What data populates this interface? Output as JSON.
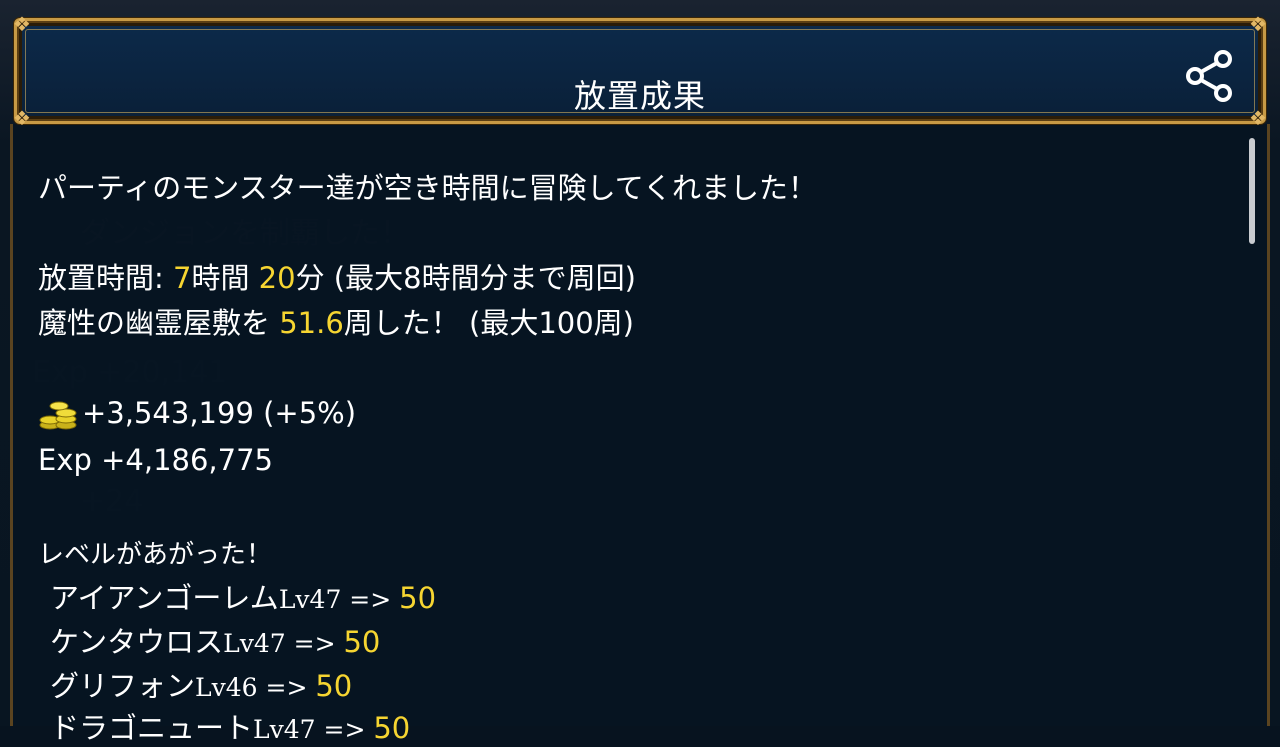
{
  "dialog": {
    "title": "放置成果",
    "share_icon": "share-icon"
  },
  "intro": "パーティのモンスター達が空き時間に冒険してくれました！",
  "idle_time": {
    "label": "放置時間: ",
    "hours": "7",
    "hours_unit": "時間 ",
    "minutes": "20",
    "minutes_unit": "分",
    "note": " (最大8時間分まで周回)"
  },
  "dungeon": {
    "prefix": "魔性の幽霊屋敷を ",
    "laps": "51.6",
    "suffix": "周した！ (最大100周)"
  },
  "rewards": {
    "coin_icon": "gold-coins-icon",
    "gold": "+3,543,199 (+5%)",
    "exp": "Exp +4,186,775"
  },
  "level_up": {
    "heading": "レベルがあがった！",
    "monsters": [
      {
        "name": "アイアンゴーレム",
        "level_text": "Lv47 => ",
        "new_level": "50"
      },
      {
        "name": "ケンタウロス",
        "level_text": "Lv47 => ",
        "new_level": "50"
      },
      {
        "name": "グリフォン",
        "level_text": "Lv46 => ",
        "new_level": "50"
      },
      {
        "name": "ドラゴニュート",
        "level_text": "Lv47 => ",
        "new_level": "50"
      }
    ]
  },
  "colors": {
    "highlight": "#f6d531",
    "frame_gold": "#c79a45",
    "header_blue": "#0c2a4a"
  }
}
